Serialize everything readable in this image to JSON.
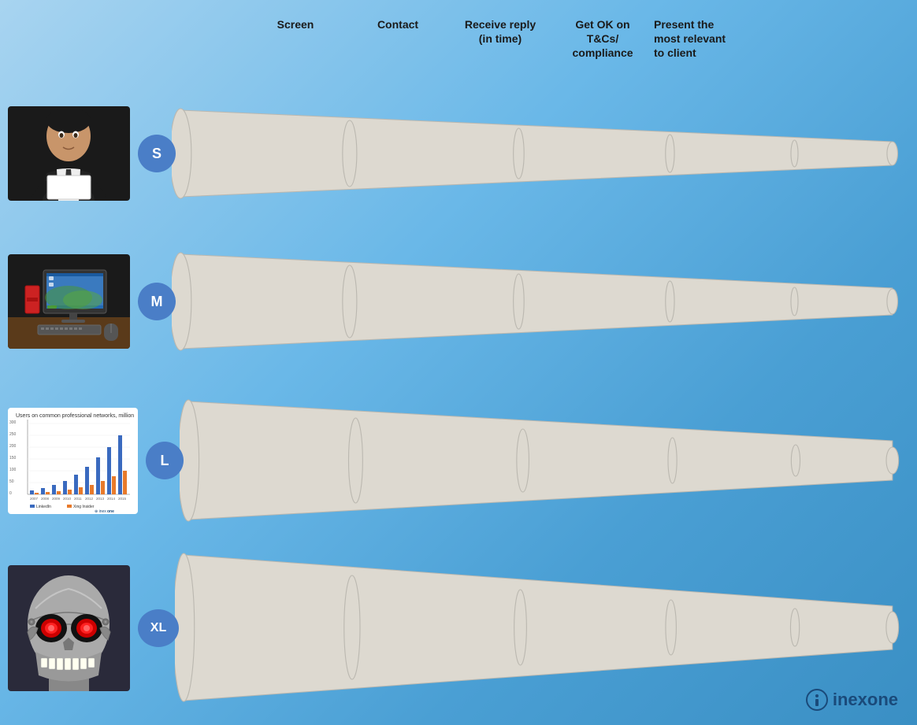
{
  "header": {
    "columns": [
      {
        "id": "screen",
        "label": "Screen"
      },
      {
        "id": "contact",
        "label": "Contact"
      },
      {
        "id": "receive",
        "label": "Receive reply\n(in time)"
      },
      {
        "id": "ok",
        "label": "Get OK on\nT&Cs/\ncompliance"
      },
      {
        "id": "present",
        "label": "Present the\nmost relevant\nto client"
      }
    ]
  },
  "rows": [
    {
      "id": "s",
      "label": "S",
      "avatar_type": "man"
    },
    {
      "id": "m",
      "label": "M",
      "avatar_type": "computer"
    },
    {
      "id": "l",
      "label": "L",
      "avatar_type": "chart"
    },
    {
      "id": "xl",
      "label": "XL",
      "avatar_type": "robot"
    }
  ],
  "logo": {
    "text": "inexone",
    "icon": "info"
  },
  "colors": {
    "badge_bg": "#4a7ec7",
    "funnel_fill": "#ddd9d0",
    "funnel_stroke": "#bbb8b0",
    "logo_text": "#1a4a7a",
    "background_start": "#a8d4f0",
    "background_end": "#3a8fc4"
  }
}
